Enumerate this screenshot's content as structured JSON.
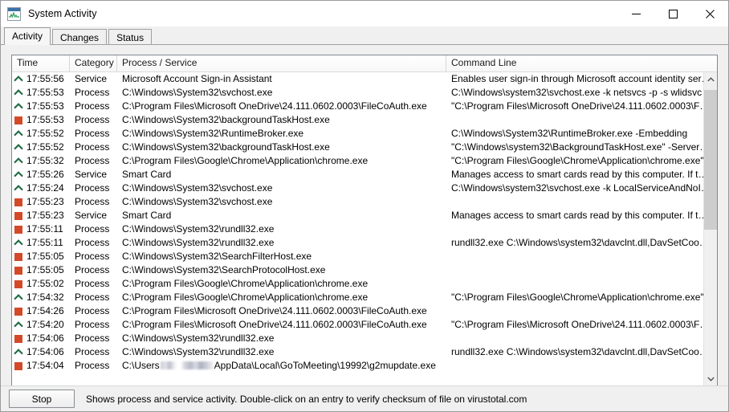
{
  "window": {
    "title": "System Activity",
    "icon": "activity-waveform-icon",
    "controls": {
      "minimize": "Minimize",
      "maximize": "Maximize",
      "close": "Close"
    }
  },
  "tabs": [
    {
      "label": "Activity",
      "active": true
    },
    {
      "label": "Changes",
      "active": false
    },
    {
      "label": "Status",
      "active": false
    }
  ],
  "table": {
    "columns": [
      {
        "key": "time",
        "label": "Time"
      },
      {
        "key": "category",
        "label": "Category"
      },
      {
        "key": "process",
        "label": "Process / Service"
      },
      {
        "key": "command",
        "label": "Command Line"
      }
    ],
    "rows": [
      {
        "icon": "chevron-up",
        "time": "17:55:56",
        "category": "Service",
        "process": "Microsoft Account Sign-in Assistant",
        "command": "Enables user sign-in through Microsoft account identity ser…"
      },
      {
        "icon": "chevron-up",
        "time": "17:55:53",
        "category": "Process",
        "process": "C:\\Windows\\System32\\svchost.exe",
        "command": "C:\\Windows\\system32\\svchost.exe -k netsvcs -p -s wlidsvc"
      },
      {
        "icon": "chevron-up",
        "time": "17:55:53",
        "category": "Process",
        "process": "C:\\Program Files\\Microsoft OneDrive\\24.111.0602.0003\\FileCoAuth.exe",
        "command": "\"C:\\Program Files\\Microsoft OneDrive\\24.111.0602.0003\\F…"
      },
      {
        "icon": "red-square",
        "time": "17:55:53",
        "category": "Process",
        "process": "C:\\Windows\\System32\\backgroundTaskHost.exe",
        "command": ""
      },
      {
        "icon": "chevron-up",
        "time": "17:55:52",
        "category": "Process",
        "process": "C:\\Windows\\System32\\RuntimeBroker.exe",
        "command": "C:\\Windows\\System32\\RuntimeBroker.exe -Embedding"
      },
      {
        "icon": "chevron-up",
        "time": "17:55:52",
        "category": "Process",
        "process": "C:\\Windows\\System32\\backgroundTaskHost.exe",
        "command": "\"C:\\Windows\\system32\\BackgroundTaskHost.exe\" -Server…"
      },
      {
        "icon": "chevron-up",
        "time": "17:55:32",
        "category": "Process",
        "process": "C:\\Program Files\\Google\\Chrome\\Application\\chrome.exe",
        "command": "\"C:\\Program Files\\Google\\Chrome\\Application\\chrome.exe\"…"
      },
      {
        "icon": "chevron-up",
        "time": "17:55:26",
        "category": "Service",
        "process": "Smart Card",
        "command": "Manages access to smart cards read by this computer. If t…"
      },
      {
        "icon": "chevron-up",
        "time": "17:55:24",
        "category": "Process",
        "process": "C:\\Windows\\System32\\svchost.exe",
        "command": "C:\\Windows\\system32\\svchost.exe -k LocalServiceAndNoI…"
      },
      {
        "icon": "red-square",
        "time": "17:55:23",
        "category": "Process",
        "process": "C:\\Windows\\System32\\svchost.exe",
        "command": ""
      },
      {
        "icon": "red-square",
        "time": "17:55:23",
        "category": "Service",
        "process": "Smart Card",
        "command": "Manages access to smart cards read by this computer. If t…"
      },
      {
        "icon": "red-square",
        "time": "17:55:11",
        "category": "Process",
        "process": "C:\\Windows\\System32\\rundll32.exe",
        "command": ""
      },
      {
        "icon": "chevron-up",
        "time": "17:55:11",
        "category": "Process",
        "process": "C:\\Windows\\System32\\rundll32.exe",
        "command": "rundll32.exe C:\\Windows\\system32\\davclnt.dll,DavSetCoo…"
      },
      {
        "icon": "red-square",
        "time": "17:55:05",
        "category": "Process",
        "process": "C:\\Windows\\System32\\SearchFilterHost.exe",
        "command": ""
      },
      {
        "icon": "red-square",
        "time": "17:55:05",
        "category": "Process",
        "process": "C:\\Windows\\System32\\SearchProtocolHost.exe",
        "command": ""
      },
      {
        "icon": "red-square",
        "time": "17:55:02",
        "category": "Process",
        "process": "C:\\Program Files\\Google\\Chrome\\Application\\chrome.exe",
        "command": ""
      },
      {
        "icon": "chevron-up",
        "time": "17:54:32",
        "category": "Process",
        "process": "C:\\Program Files\\Google\\Chrome\\Application\\chrome.exe",
        "command": "\"C:\\Program Files\\Google\\Chrome\\Application\\chrome.exe\"…"
      },
      {
        "icon": "red-square",
        "time": "17:54:26",
        "category": "Process",
        "process": "C:\\Program Files\\Microsoft OneDrive\\24.111.0602.0003\\FileCoAuth.exe",
        "command": ""
      },
      {
        "icon": "chevron-up",
        "time": "17:54:20",
        "category": "Process",
        "process": "C:\\Program Files\\Microsoft OneDrive\\24.111.0602.0003\\FileCoAuth.exe",
        "command": "\"C:\\Program Files\\Microsoft OneDrive\\24.111.0602.0003\\F…"
      },
      {
        "icon": "red-square",
        "time": "17:54:06",
        "category": "Process",
        "process": "C:\\Windows\\System32\\rundll32.exe",
        "command": ""
      },
      {
        "icon": "chevron-up",
        "time": "17:54:06",
        "category": "Process",
        "process": "C:\\Windows\\System32\\rundll32.exe",
        "command": "rundll32.exe C:\\Windows\\system32\\davclnt.dll,DavSetCoo…"
      },
      {
        "icon": "red-square",
        "time": "17:54:04",
        "category": "Process",
        "process_prefix": "C:\\Users",
        "process_redacted": true,
        "process_suffix": "AppData\\Local\\GoToMeeting\\19992\\g2mupdate.exe",
        "command": ""
      }
    ]
  },
  "scrollbar": {
    "up_arrow": "chevron-up-icon",
    "down_arrow": "chevron-down-icon"
  },
  "statusbar": {
    "stop_label": "Stop",
    "hint": "Shows process and service activity. Double-click on an entry to verify checksum of file on virustotal.com"
  },
  "colors": {
    "icon_green": "#1e6b44",
    "icon_red": "#d34a29",
    "accent_blue": "#3b72a8",
    "window_bg": "#f0f0f0"
  }
}
